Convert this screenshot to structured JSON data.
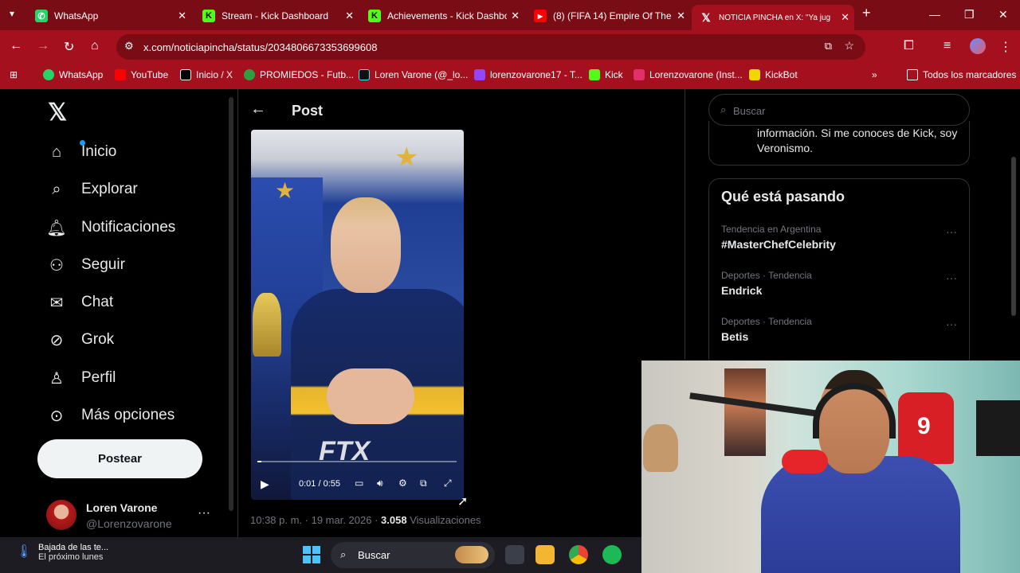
{
  "browser": {
    "tabs": [
      {
        "label": "WhatsApp",
        "icon": "whatsapp-icon"
      },
      {
        "label": "Stream - Kick Dashboard",
        "icon": "kick-icon"
      },
      {
        "label": "Achievements - Kick Dashbo",
        "icon": "kick-icon"
      },
      {
        "label": "(8) (FIFA 14) Empire Of The S",
        "icon": "youtube-icon"
      },
      {
        "label": "NOTICIA PINCHA en X: \"Ya jug",
        "icon": "x-icon"
      }
    ],
    "url": "x.com/noticiapincha/status/2034806673353699608",
    "bookmarks": [
      {
        "label": "WhatsApp",
        "color": "#25d366"
      },
      {
        "label": "YouTube",
        "color": "#ff0000"
      },
      {
        "label": "Inicio / X",
        "color": "#000000"
      },
      {
        "label": "PROMIEDOS - Futb...",
        "color": "#2e9e3e"
      },
      {
        "label": "Loren Varone (@_lo...",
        "color": "#111111"
      },
      {
        "label": "lorenzovarone17 - T...",
        "color": "#9146ff"
      },
      {
        "label": "Kick",
        "color": "#53fc18"
      },
      {
        "label": "Lorenzovarone (Inst...",
        "color": "#e1306c"
      },
      {
        "label": "KickBot",
        "color": "#f2d600"
      }
    ],
    "all_bookmarks": "Todos los marcadores"
  },
  "sidebar": {
    "items": [
      {
        "label": "Inicio",
        "icon": "home-icon"
      },
      {
        "label": "Explorar",
        "icon": "search-icon"
      },
      {
        "label": "Notificaciones",
        "icon": "bell-icon"
      },
      {
        "label": "Seguir",
        "icon": "follow-icon"
      },
      {
        "label": "Chat",
        "icon": "mail-icon"
      },
      {
        "label": "Grok",
        "icon": "grok-icon"
      },
      {
        "label": "Perfil",
        "icon": "person-icon"
      },
      {
        "label": "Más opciones",
        "icon": "more-icon"
      }
    ],
    "post_button": "Postear",
    "profile": {
      "name": "Loren Varone",
      "handle": "@Lorenzovarone"
    }
  },
  "post": {
    "header": "Post",
    "video": {
      "time": "0:01 / 0:55",
      "progress": 0.02,
      "watermark": "FTX"
    },
    "timestamp": "10:38 p. m. · 19 mar. 2026 · ",
    "views_count": "3.058",
    "views_label": " Visualizaciones"
  },
  "right": {
    "search_placeholder": "Buscar",
    "bio": "información. Si me conoces de Kick, soy Veronismo.",
    "trends_title": "Qué está pasando",
    "trends": [
      {
        "context": "Tendencia en Argentina",
        "name": "#MasterChefCelebrity"
      },
      {
        "context": "Deportes · Tendencia",
        "name": "Endrick"
      },
      {
        "context": "Deportes · Tendencia",
        "name": "Betis"
      }
    ]
  },
  "taskbar": {
    "weather_line1": "Bajada de las te...",
    "weather_line2": "El próximo lunes",
    "search_label": "Buscar"
  },
  "webcam": {
    "jersey_number": "9"
  }
}
